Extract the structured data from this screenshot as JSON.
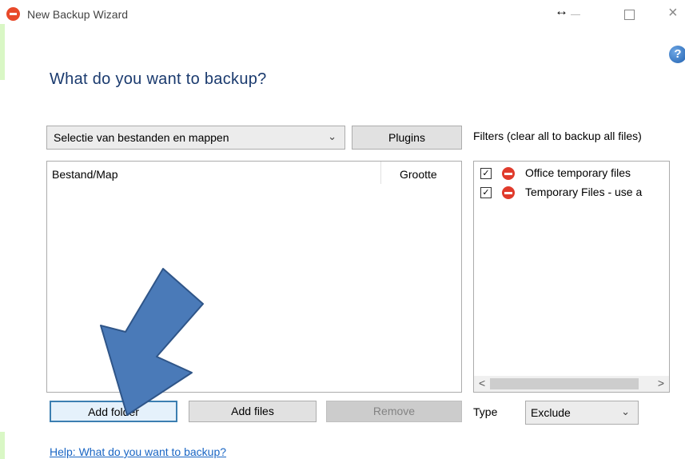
{
  "window": {
    "title": "New Backup Wizard",
    "icon": "backup-app-icon",
    "controls": {
      "resize": "↔",
      "minimize": "–",
      "maximize": "□",
      "close": "✕"
    },
    "help_icon_glyph": "?"
  },
  "heading": "What do you want to backup?",
  "source_select": {
    "value": "Selectie van bestanden en mappen"
  },
  "plugins_label": "Plugins",
  "filters_label": "Filters (clear all to backup all files)",
  "file_list": {
    "columns": [
      "Bestand/Map",
      "Grootte"
    ],
    "rows": []
  },
  "filters": [
    {
      "checked": true,
      "label": "Office temporary files"
    },
    {
      "checked": true,
      "label": "Temporary Files - use a"
    }
  ],
  "buttons": {
    "add_folder": "Add folder",
    "add_files": "Add files",
    "remove": "Remove"
  },
  "type_label": "Type",
  "type_select": {
    "value": "Exclude"
  },
  "help_link": "Help: What do you want to backup?",
  "colors": {
    "accent_arrow": "#4a7ab8",
    "heading": "#1a3a6e",
    "link": "#1a66c4",
    "stop_icon": "#e03b2c"
  }
}
